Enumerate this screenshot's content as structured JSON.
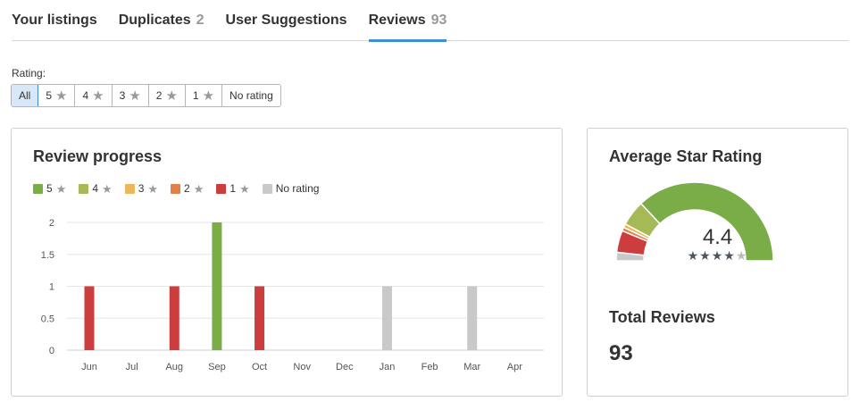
{
  "tabs": [
    {
      "label": "Your listings",
      "count": "",
      "active": false
    },
    {
      "label": "Duplicates",
      "count": "2",
      "active": false
    },
    {
      "label": "User Suggestions",
      "count": "",
      "active": false
    },
    {
      "label": "Reviews",
      "count": "93",
      "active": true
    }
  ],
  "rating_filter": {
    "label": "Rating:",
    "options": [
      {
        "label": "All",
        "star": false,
        "active": true
      },
      {
        "label": "5",
        "star": true,
        "active": false
      },
      {
        "label": "4",
        "star": true,
        "active": false
      },
      {
        "label": "3",
        "star": true,
        "active": false
      },
      {
        "label": "2",
        "star": true,
        "active": false
      },
      {
        "label": "1",
        "star": true,
        "active": false
      },
      {
        "label": "No rating",
        "star": false,
        "active": false
      }
    ]
  },
  "review_progress": {
    "title": "Review progress",
    "legend": [
      {
        "label": "5",
        "star": true,
        "color": "#7aad48"
      },
      {
        "label": "4",
        "star": true,
        "color": "#a6b957"
      },
      {
        "label": "3",
        "star": true,
        "color": "#ecb75a"
      },
      {
        "label": "2",
        "star": true,
        "color": "#e07f4c"
      },
      {
        "label": "1",
        "star": true,
        "color": "#cc3d3d"
      },
      {
        "label": "No rating",
        "star": false,
        "color": "#c9c9c9"
      }
    ]
  },
  "chart_data": {
    "type": "bar",
    "categories": [
      "Jun",
      "Jul",
      "Aug",
      "Sep",
      "Oct",
      "Nov",
      "Dec",
      "Jan",
      "Feb",
      "Mar",
      "Apr"
    ],
    "series": [
      {
        "name": "5",
        "color": "#7aad48",
        "values": [
          0,
          0,
          0,
          2,
          0,
          0,
          0,
          0,
          0,
          0,
          0
        ]
      },
      {
        "name": "4",
        "color": "#a6b957",
        "values": [
          0,
          0,
          0,
          0,
          0,
          0,
          0,
          0,
          0,
          0,
          0
        ]
      },
      {
        "name": "3",
        "color": "#ecb75a",
        "values": [
          0,
          0,
          0,
          0,
          0,
          0,
          0,
          0,
          0,
          0,
          0
        ]
      },
      {
        "name": "2",
        "color": "#e07f4c",
        "values": [
          0,
          0,
          0,
          0,
          0,
          0,
          0,
          0,
          0,
          0,
          0
        ]
      },
      {
        "name": "1",
        "color": "#cc3d3d",
        "values": [
          1,
          0,
          1,
          0,
          1,
          0,
          0,
          0,
          0,
          0,
          0
        ]
      },
      {
        "name": "No rating",
        "color": "#c9c9c9",
        "values": [
          0,
          0,
          0,
          0,
          0,
          0,
          0,
          1,
          0,
          1,
          0
        ]
      }
    ],
    "yticks": [
      "0",
      "0.5",
      "1",
      "1.5",
      "2"
    ],
    "ylim": [
      0,
      2
    ],
    "grid": true,
    "legend": "top-left"
  },
  "average": {
    "title": "Average Star Rating",
    "value": "4.4",
    "rating": 4.4,
    "stars_filled": 4,
    "stars_total": 5,
    "gauge_segments": [
      {
        "name": "No rating",
        "color": "#c9c9c9",
        "fraction": 0.035
      },
      {
        "name": "1",
        "color": "#cc3d3d",
        "fraction": 0.09
      },
      {
        "name": "2",
        "color": "#e07f4c",
        "fraction": 0.015
      },
      {
        "name": "3",
        "color": "#ecb75a",
        "fraction": 0.015
      },
      {
        "name": "4",
        "color": "#a6b957",
        "fraction": 0.105
      },
      {
        "name": "5",
        "color": "#7aad48",
        "fraction": 0.74
      }
    ]
  },
  "total": {
    "title": "Total Reviews",
    "value": "93"
  }
}
